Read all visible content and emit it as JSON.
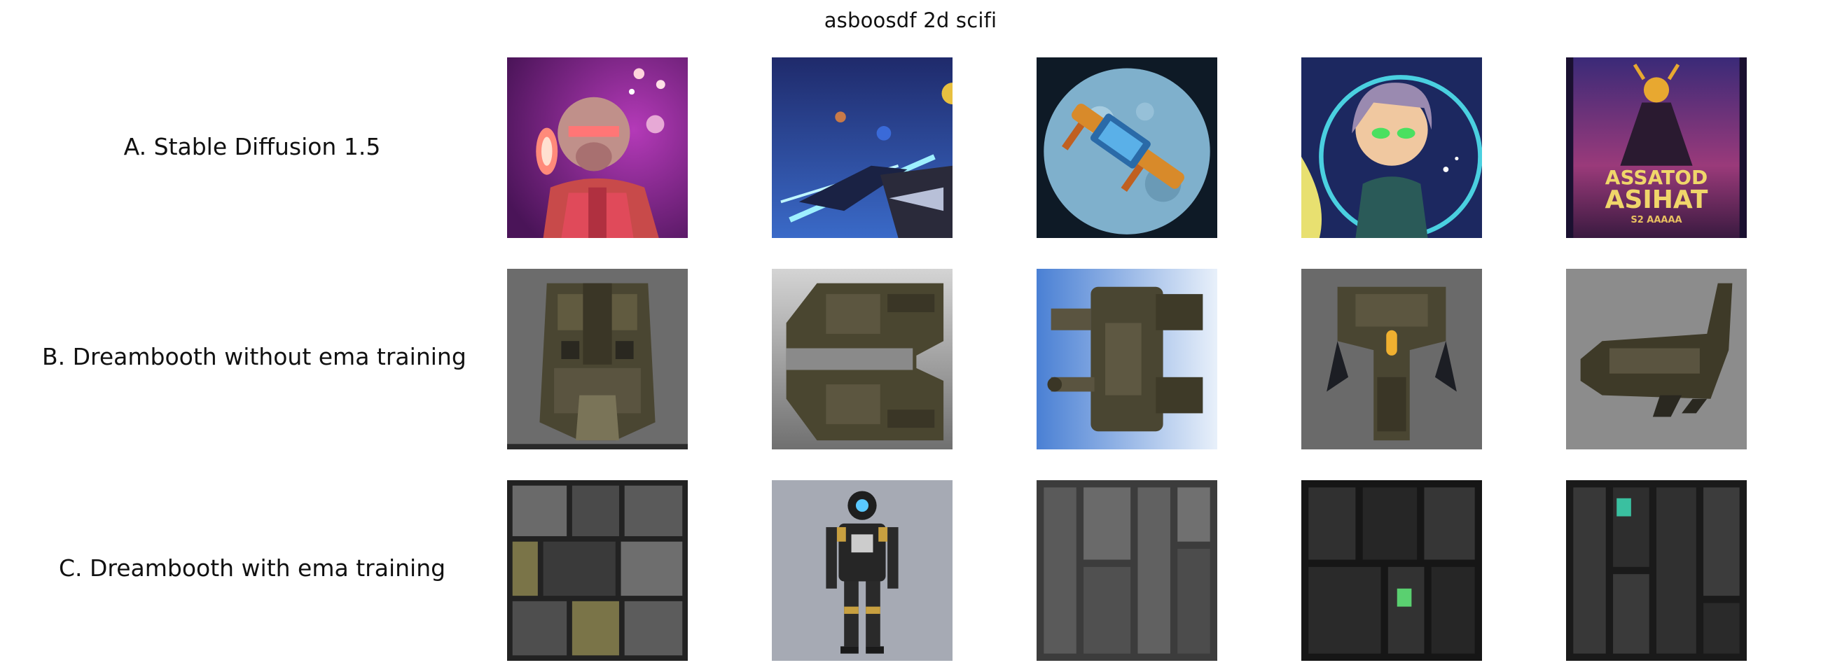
{
  "title": "asboosdf 2d scifi",
  "rows": [
    {
      "label": "A. Stable Diffusion 1.5"
    },
    {
      "label": "B. Dreambooth without ema training"
    },
    {
      "label": "C. Dreambooth with ema training"
    }
  ],
  "image_text": {
    "poster_line1": "ASSATOD",
    "poster_line2": "ASIHAT",
    "poster_line3": "S2 AAAAA"
  },
  "images": [
    [
      "astronaut-character",
      "spaceship-battle",
      "planet-with-weapon",
      "anime-girl-portrait",
      "scifi-poster"
    ],
    [
      "armored-pod-sprite",
      "blocky-ship-sprite",
      "turret-sprite",
      "fighter-ship-sprite",
      "shuttle-sprite"
    ],
    [
      "panel-texture-yellow",
      "robot-figure",
      "panel-texture-gray",
      "panel-texture-dark",
      "panel-texture-green"
    ]
  ]
}
